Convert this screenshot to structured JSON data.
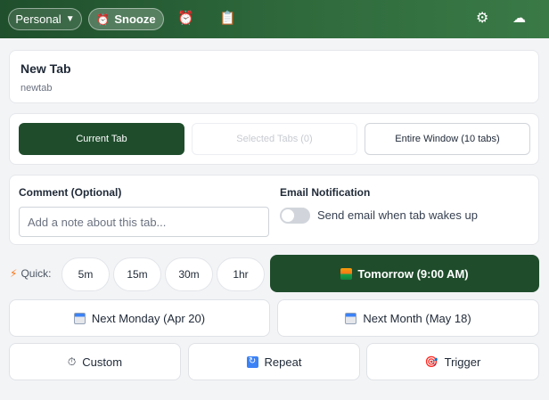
{
  "header": {
    "profile_label": "Personal",
    "profile_caret": "▼",
    "snooze_icon": "⏰",
    "snooze_label": "Snooze",
    "icons": [
      "alarm-icon",
      "clipboard-icon",
      "gear-icon",
      "cloud-icon"
    ],
    "alarm_glyph": "⏰",
    "clipboard_glyph": "📋",
    "gear_glyph": "⚙",
    "cloud_glyph": "☁"
  },
  "tab": {
    "title": "New Tab",
    "url": "newtab"
  },
  "scope": {
    "current": "Current Tab",
    "selected": "Selected Tabs (0)",
    "window": "Entire Window (10 tabs)"
  },
  "options": {
    "comment_label": "Comment (Optional)",
    "comment_placeholder": "Add a note about this tab...",
    "email_label": "Email Notification",
    "email_toggle_text": "Send email when tab wakes up",
    "email_enabled": false
  },
  "quick": {
    "label": "Quick:",
    "bolt": "⚡",
    "options": [
      "5m",
      "15m",
      "30m",
      "1hr"
    ]
  },
  "presets": {
    "tomorrow": "Tomorrow (9:00 AM)",
    "next_monday": "Next Monday (Apr 20)",
    "next_month": "Next Month (May 18)",
    "custom": "Custom",
    "repeat": "Repeat",
    "trigger": "Trigger",
    "custom_glyph": "⏱",
    "repeat_glyph": "↻",
    "trigger_glyph": "🎯"
  },
  "colors": {
    "accent": "#1f4d2c",
    "header_start": "#1f4f2c",
    "header_end": "#3a7a47"
  }
}
